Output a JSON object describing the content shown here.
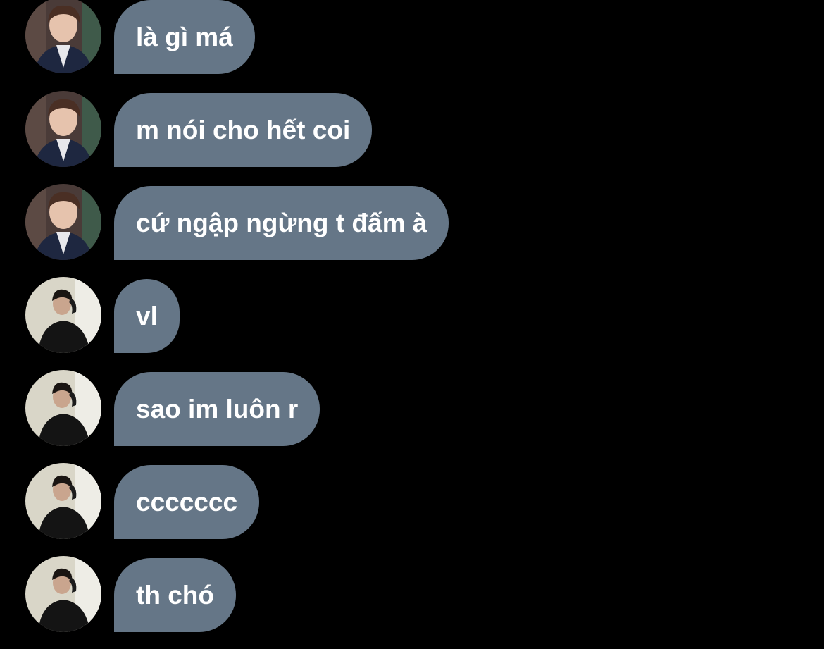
{
  "messages": [
    {
      "text": "là gì má",
      "avatar": "boy-hanbok-avatar"
    },
    {
      "text": "m nói cho hết coi",
      "avatar": "boy-hanbok-avatar"
    },
    {
      "text": "cứ ngập ngừng t đấm à",
      "avatar": "boy-hanbok-avatar"
    },
    {
      "text": "vl",
      "avatar": "man-black-coat-avatar"
    },
    {
      "text": "sao im luôn r",
      "avatar": "man-black-coat-avatar"
    },
    {
      "text": "ccccccc",
      "avatar": "man-black-coat-avatar"
    },
    {
      "text": "th chó",
      "avatar": "man-black-coat-avatar"
    }
  ],
  "colors": {
    "background": "#000000",
    "bubble": "#657687",
    "text": "#ffffff"
  }
}
